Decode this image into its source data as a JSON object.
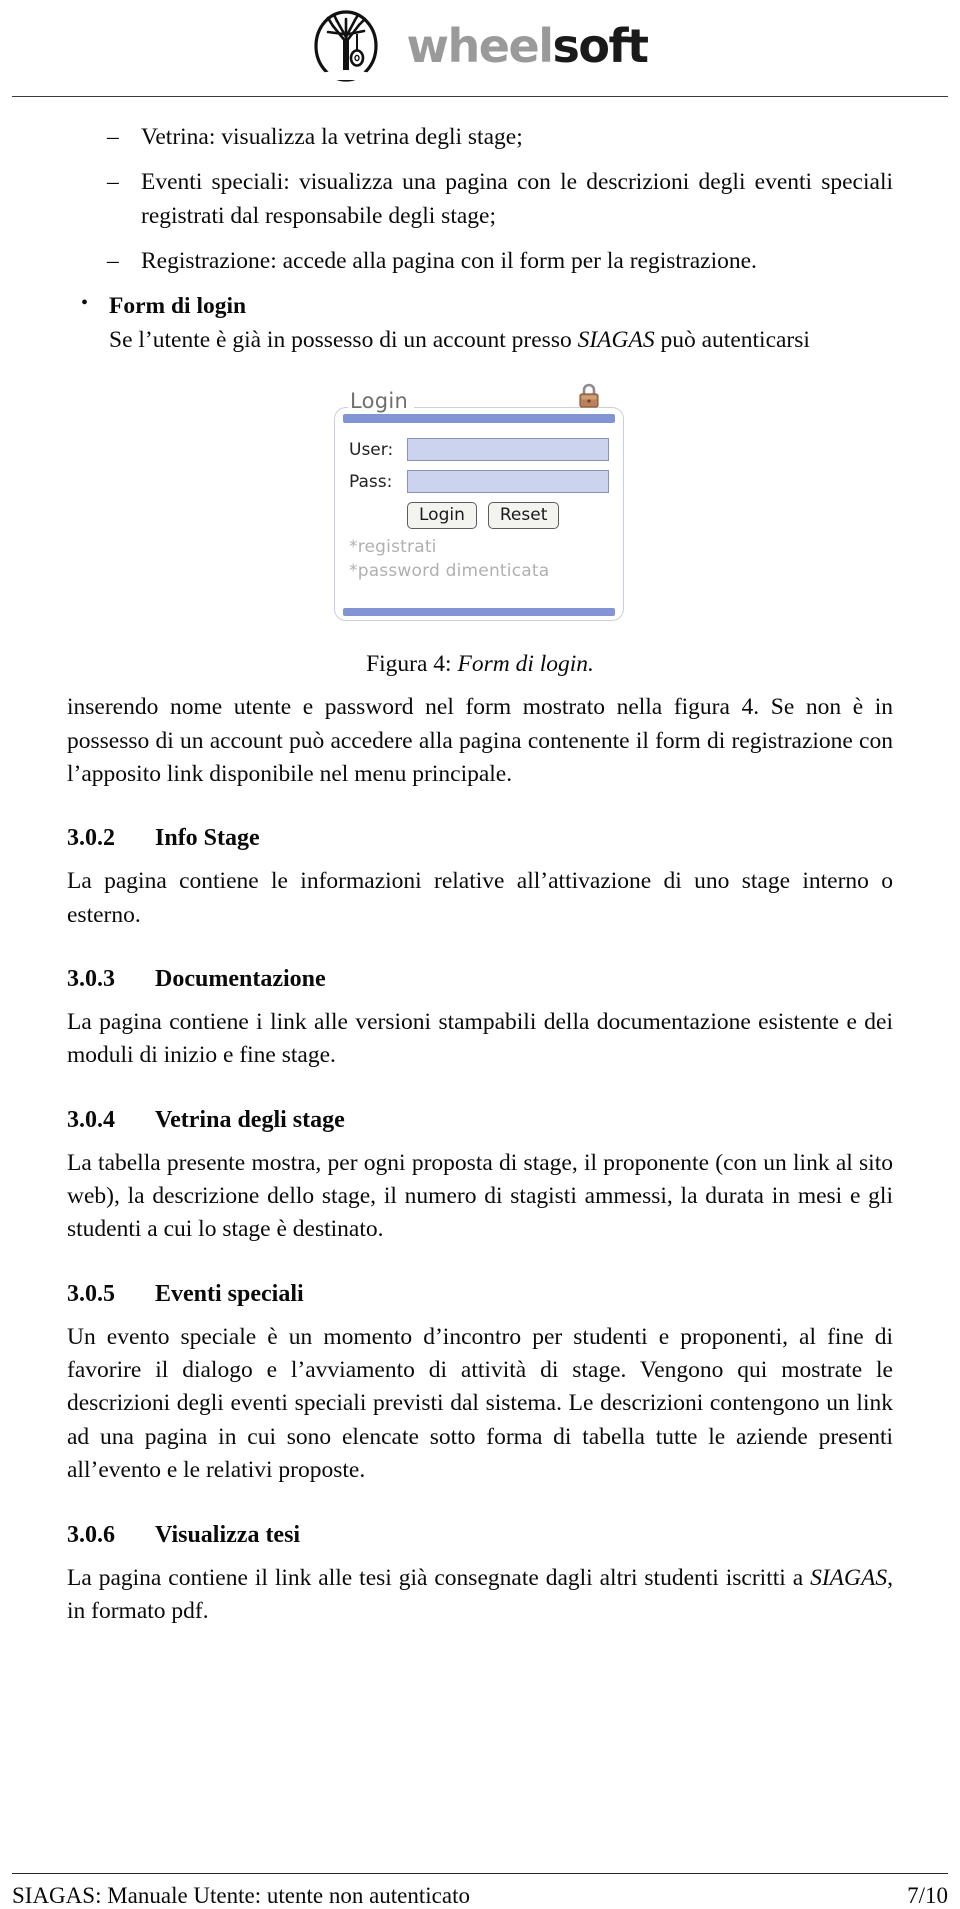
{
  "header": {
    "logo": {
      "mark_name": "tree-with-tire-swing-logo",
      "word_part_1": "wheel",
      "word_part_2": "soft",
      "color_word_1": "#9a9a9a",
      "color_word_2": "#1a1a1a"
    }
  },
  "intro_list": [
    "Vetrina: visualizza la vetrina degli stage;",
    "Eventi speciali: visualizza una pagina con le descrizioni degli eventi speciali registrati dal responsabile degli stage;",
    "Registrazione: accede alla pagina con il form per la registrazione."
  ],
  "form_bullet": {
    "heading": "Form di login",
    "text_before_italic": "Se l’utente è già in possesso di un account presso ",
    "italic_term": "SIAGAS",
    "text_after_italic": " può autenticarsi"
  },
  "login_figure": {
    "title": "Login",
    "lock_icon": "padlock-icon",
    "fields": [
      {
        "label": "User:",
        "value": "",
        "placeholder": ""
      },
      {
        "label": "Pass:",
        "value": "",
        "placeholder": ""
      }
    ],
    "buttons": [
      {
        "label": "Login"
      },
      {
        "label": "Reset"
      }
    ],
    "links": [
      "*registrati",
      "*password dimenticata"
    ],
    "accent_color": "#8294d4",
    "input_color": "#ccd3ee",
    "caption_prefix": "Figura 4:",
    "caption_italic": "Form di login."
  },
  "after_figure_paragraph": "inserendo nome utente e password nel form mostrato nella figura 4. Se non è in possesso di un account può accedere alla pagina contenente il form di registrazione con l’apposito link disponibile nel menu principale.",
  "sections": [
    {
      "number": "3.0.2",
      "title": "Info Stage",
      "body": "La pagina contiene le informazioni relative all’attivazione di uno stage interno o esterno."
    },
    {
      "number": "3.0.3",
      "title": "Documentazione",
      "body": "La pagina contiene i link alle versioni stampabili della documentazione esistente e dei moduli di inizio e fine stage."
    },
    {
      "number": "3.0.4",
      "title": "Vetrina degli stage",
      "body": "La tabella presente mostra, per ogni proposta di stage, il proponente (con un link al sito web), la descrizione dello stage, il numero di stagisti ammessi, la durata in mesi e gli studenti a cui lo stage è destinato."
    },
    {
      "number": "3.0.5",
      "title": "Eventi speciali",
      "body": "Un evento speciale è un momento d’incontro per studenti e proponenti, al fine di favorire il dialogo e l’avviamento di attività di stage. Vengono qui mostrate le descrizioni degli eventi speciali previsti dal sistema. Le descrizioni contengono un link ad una pagina in cui sono elencate sotto forma di tabella tutte le aziende presenti all’evento e le relativi proposte."
    }
  ],
  "last_section": {
    "number": "3.0.6",
    "title": "Visualizza tesi",
    "body_before_italic": "La pagina contiene il link alle tesi già consegnate dagli altri studenti iscritti a ",
    "italic_term": "SIAGAS",
    "body_after_italic": ", in formato pdf."
  },
  "footer": {
    "left": "SIAGAS: Manuale Utente: utente non autenticato",
    "right": "7/10"
  }
}
